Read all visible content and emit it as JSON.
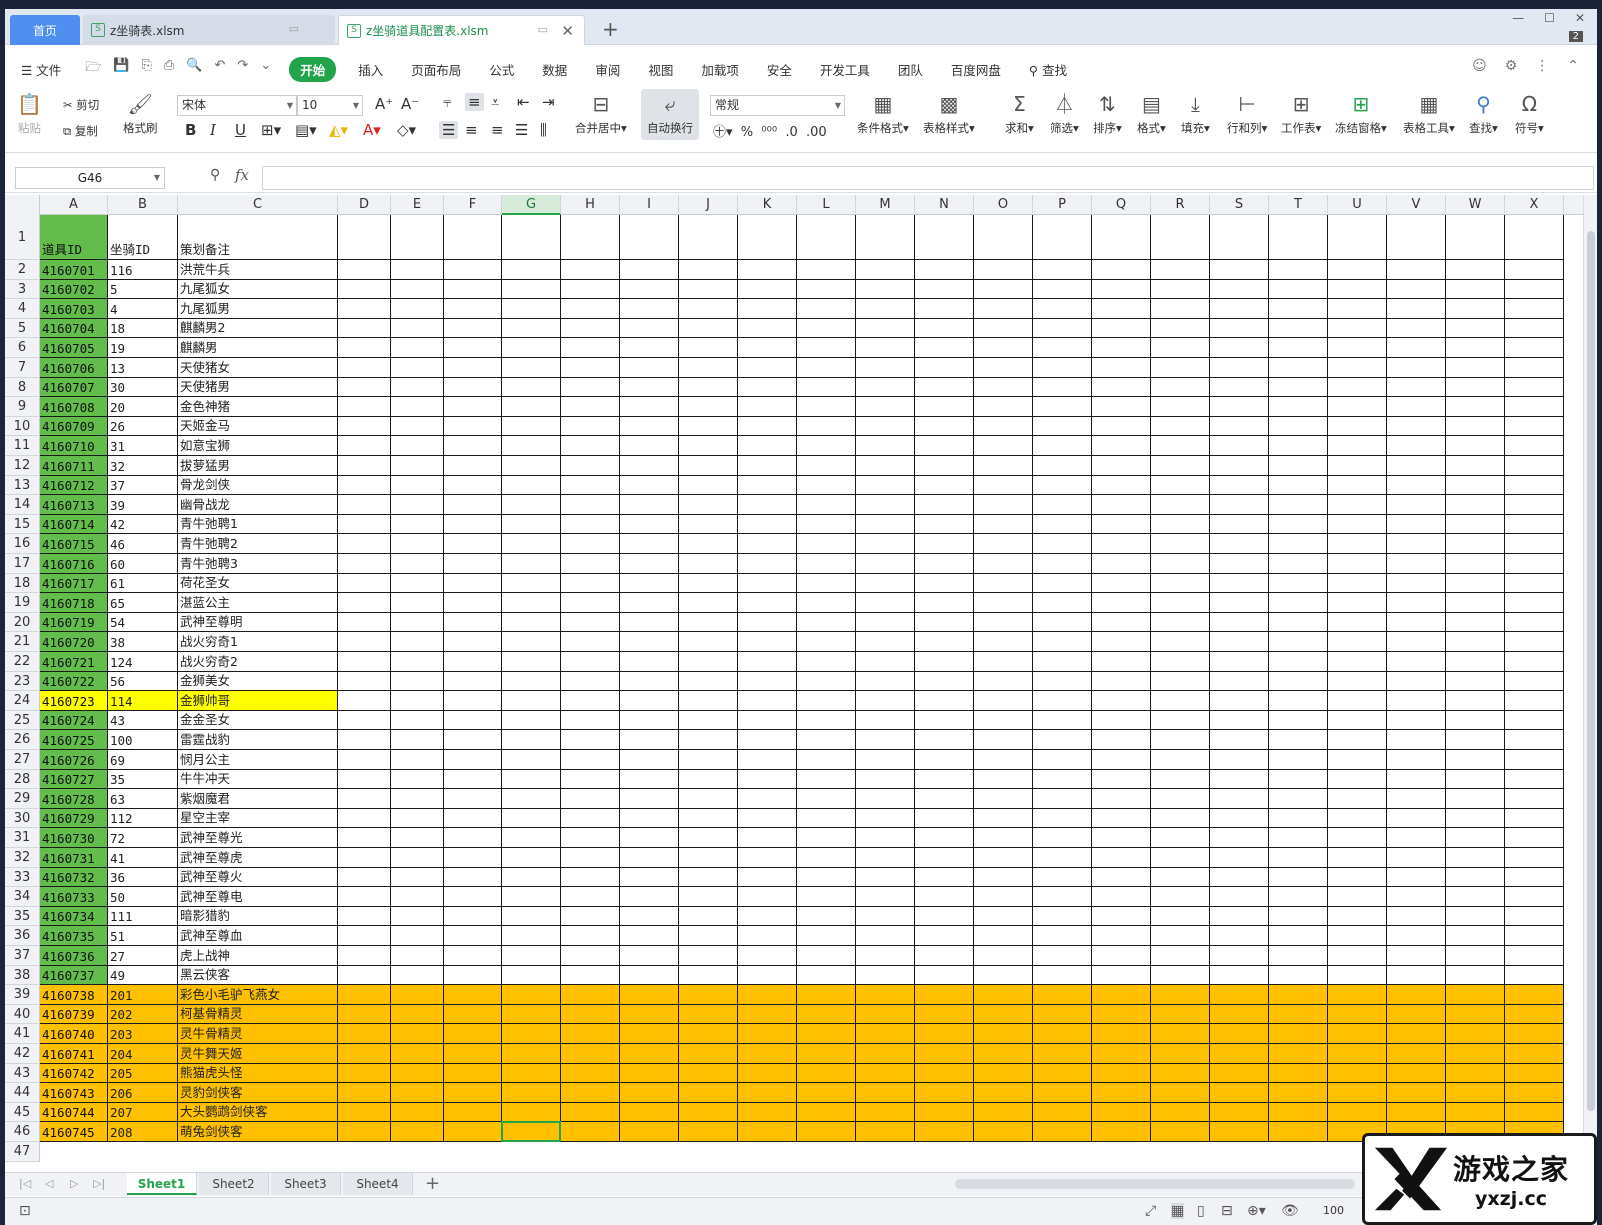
{
  "tabs": {
    "home": "首页",
    "file1": "z坐骑表.xlsm",
    "file2": "z坐骑道具配置表.xlsm",
    "add": "+",
    "window_count": "2"
  },
  "menu": {
    "file": "文件",
    "start": "开始",
    "insert": "插入",
    "page_layout": "页面布局",
    "formula": "公式",
    "data": "数据",
    "review": "审阅",
    "view": "视图",
    "addins": "加载项",
    "security": "安全",
    "dev_tools": "开发工具",
    "team": "团队",
    "baidu_disk": "百度网盘",
    "search": "查找"
  },
  "ribbon": {
    "paste": "粘贴",
    "cut": "剪切",
    "copy": "复制",
    "format_painter": "格式刷",
    "font_name": "宋体",
    "font_size": "10",
    "merge_center": "合并居中",
    "auto_wrap": "自动换行",
    "number_format": "常规",
    "cond_format": "条件格式",
    "table_style": "表格样式",
    "sum": "求和",
    "filter": "筛选",
    "sort": "排序",
    "format": "格式",
    "fill": "填充",
    "row_col": "行和列",
    "worksheet": "工作表",
    "freeze": "冻结窗格",
    "table_tools": "表格工具",
    "find": "查找",
    "symbol": "符号"
  },
  "formula_bar": {
    "name_box": "G46",
    "fx": "fx",
    "content": ""
  },
  "columns": [
    "A",
    "B",
    "C",
    "D",
    "E",
    "F",
    "G",
    "H",
    "I",
    "J",
    "K",
    "L",
    "M",
    "N",
    "O",
    "P",
    "Q",
    "R",
    "S",
    "T",
    "U",
    "V",
    "W",
    "X"
  ],
  "selected_column": "G",
  "header_row": {
    "num": "1",
    "a": "道具ID",
    "b": "坐骑ID",
    "c": "策划备注"
  },
  "rows": [
    {
      "num": "2",
      "a": "4160701",
      "b": "116",
      "c": "洪荒牛兵",
      "hl": ""
    },
    {
      "num": "3",
      "a": "4160702",
      "b": "5",
      "c": "九尾狐女",
      "hl": ""
    },
    {
      "num": "4",
      "a": "4160703",
      "b": "4",
      "c": "九尾狐男",
      "hl": ""
    },
    {
      "num": "5",
      "a": "4160704",
      "b": "18",
      "c": "麒麟男2",
      "hl": ""
    },
    {
      "num": "6",
      "a": "4160705",
      "b": "19",
      "c": "麒麟男",
      "hl": ""
    },
    {
      "num": "7",
      "a": "4160706",
      "b": "13",
      "c": "天使猪女",
      "hl": ""
    },
    {
      "num": "8",
      "a": "4160707",
      "b": "30",
      "c": "天使猪男",
      "hl": ""
    },
    {
      "num": "9",
      "a": "4160708",
      "b": "20",
      "c": "金色神猪",
      "hl": ""
    },
    {
      "num": "10",
      "a": "4160709",
      "b": "26",
      "c": "天姬金马",
      "hl": ""
    },
    {
      "num": "11",
      "a": "4160710",
      "b": "31",
      "c": "如意宝狮",
      "hl": ""
    },
    {
      "num": "12",
      "a": "4160711",
      "b": "32",
      "c": "拔萝猛男",
      "hl": ""
    },
    {
      "num": "13",
      "a": "4160712",
      "b": "37",
      "c": "骨龙剑侠",
      "hl": ""
    },
    {
      "num": "14",
      "a": "4160713",
      "b": "39",
      "c": "幽骨战龙",
      "hl": ""
    },
    {
      "num": "15",
      "a": "4160714",
      "b": "42",
      "c": "青牛弛聘1",
      "hl": ""
    },
    {
      "num": "16",
      "a": "4160715",
      "b": "46",
      "c": "青牛弛聘2",
      "hl": ""
    },
    {
      "num": "17",
      "a": "4160716",
      "b": "60",
      "c": "青牛弛聘3",
      "hl": ""
    },
    {
      "num": "18",
      "a": "4160717",
      "b": "61",
      "c": "荷花圣女",
      "hl": ""
    },
    {
      "num": "19",
      "a": "4160718",
      "b": "65",
      "c": "湛蓝公主",
      "hl": ""
    },
    {
      "num": "20",
      "a": "4160719",
      "b": "54",
      "c": "武神至尊明",
      "hl": ""
    },
    {
      "num": "21",
      "a": "4160720",
      "b": "38",
      "c": "战火穷奇1",
      "hl": ""
    },
    {
      "num": "22",
      "a": "4160721",
      "b": "124",
      "c": "战火穷奇2",
      "hl": ""
    },
    {
      "num": "23",
      "a": "4160722",
      "b": "56",
      "c": "金狮美女",
      "hl": ""
    },
    {
      "num": "24",
      "a": "4160723",
      "b": "114",
      "c": "金狮帅哥",
      "hl": "y"
    },
    {
      "num": "25",
      "a": "4160724",
      "b": "43",
      "c": "金金圣女",
      "hl": ""
    },
    {
      "num": "26",
      "a": "4160725",
      "b": "100",
      "c": "雷霆战豹",
      "hl": ""
    },
    {
      "num": "27",
      "a": "4160726",
      "b": "69",
      "c": "悯月公主",
      "hl": ""
    },
    {
      "num": "28",
      "a": "4160727",
      "b": "35",
      "c": "牛牛冲天",
      "hl": ""
    },
    {
      "num": "29",
      "a": "4160728",
      "b": "63",
      "c": "紫烟魔君",
      "hl": ""
    },
    {
      "num": "30",
      "a": "4160729",
      "b": "112",
      "c": "星空主宰",
      "hl": ""
    },
    {
      "num": "31",
      "a": "4160730",
      "b": "72",
      "c": "武神至尊光",
      "hl": ""
    },
    {
      "num": "32",
      "a": "4160731",
      "b": "41",
      "c": "武神至尊虎",
      "hl": ""
    },
    {
      "num": "33",
      "a": "4160732",
      "b": "36",
      "c": "武神至尊火",
      "hl": ""
    },
    {
      "num": "34",
      "a": "4160733",
      "b": "50",
      "c": "武神至尊电",
      "hl": ""
    },
    {
      "num": "35",
      "a": "4160734",
      "b": "111",
      "c": "暗影猎豹",
      "hl": ""
    },
    {
      "num": "36",
      "a": "4160735",
      "b": "51",
      "c": "武神至尊血",
      "hl": ""
    },
    {
      "num": "37",
      "a": "4160736",
      "b": "27",
      "c": "虎上战神",
      "hl": ""
    },
    {
      "num": "38",
      "a": "4160737",
      "b": "49",
      "c": "黑云侠客",
      "hl": ""
    },
    {
      "num": "39",
      "a": "4160738",
      "b": "201",
      "c": "彩色小毛驴飞燕女",
      "hl": "o"
    },
    {
      "num": "40",
      "a": "4160739",
      "b": "202",
      "c": "柯基骨精灵",
      "hl": "o"
    },
    {
      "num": "41",
      "a": "4160740",
      "b": "203",
      "c": "灵牛骨精灵",
      "hl": "o"
    },
    {
      "num": "42",
      "a": "4160741",
      "b": "204",
      "c": "灵牛舞天姬",
      "hl": "o"
    },
    {
      "num": "43",
      "a": "4160742",
      "b": "205",
      "c": "熊猫虎头怪",
      "hl": "o"
    },
    {
      "num": "44",
      "a": "4160743",
      "b": "206",
      "c": "灵豹剑侠客",
      "hl": "o"
    },
    {
      "num": "45",
      "a": "4160744",
      "b": "207",
      "c": "大头鹦鹉剑侠客",
      "hl": "o"
    },
    {
      "num": "46",
      "a": "4160745",
      "b": "208",
      "c": "萌兔剑侠客",
      "hl": "o"
    },
    {
      "num": "47",
      "a": "",
      "b": "",
      "c": "",
      "hl": "none"
    }
  ],
  "sheets": [
    "Sheet1",
    "Sheet2",
    "Sheet3",
    "Sheet4"
  ],
  "active_sheet": "Sheet1",
  "status": {
    "zoom": "100"
  },
  "watermark": {
    "title": "游戏之家",
    "url": "yxzj.cc"
  },
  "colors": {
    "green_col": "#63bd4b",
    "yellow_row": "#ffff00",
    "orange_rows": "#ffc000",
    "accent": "#22a44a"
  }
}
